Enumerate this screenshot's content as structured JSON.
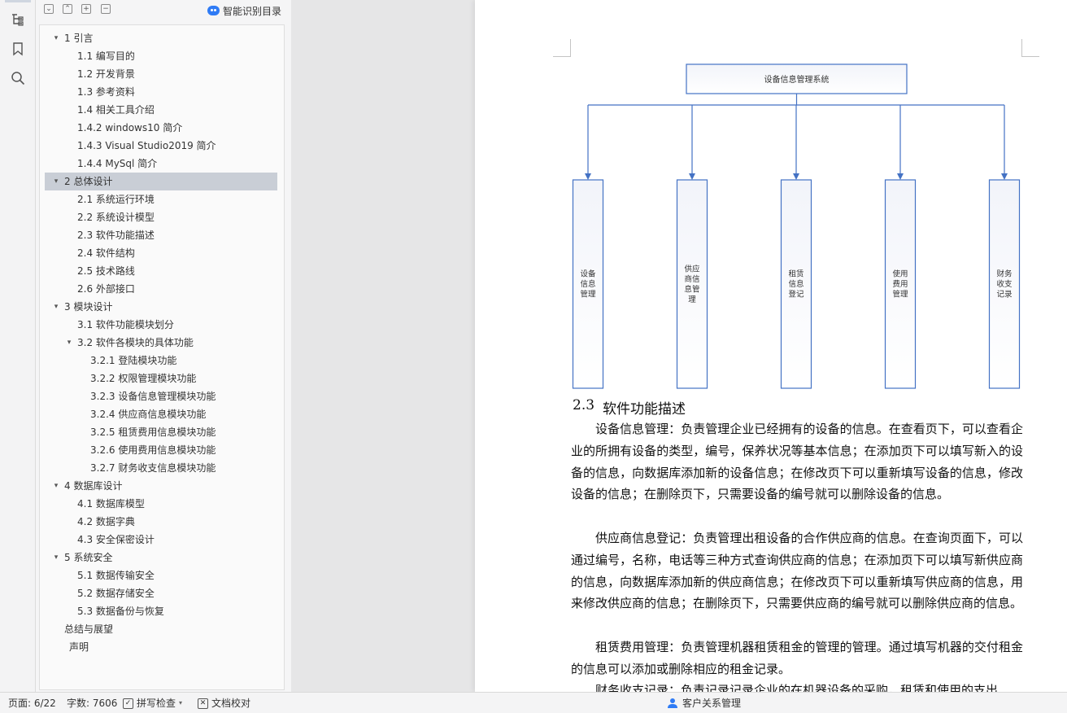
{
  "outline": {
    "smart_toc_label": "智能识别目录",
    "items": [
      {
        "label": "1  引言",
        "level": 1,
        "expanded": true
      },
      {
        "label": "1.1  编写目的",
        "level": 2
      },
      {
        "label": "1.2  开发背景",
        "level": 2
      },
      {
        "label": "1.3  参考资料",
        "level": 2
      },
      {
        "label": "1.4  相关工具介绍",
        "level": 2
      },
      {
        "label": "1.4.2 windows10 简介",
        "level": 2
      },
      {
        "label": "1.4.3 Visual Studio2019 简介",
        "level": 2
      },
      {
        "label": "1.4.4 MySql 简介",
        "level": 2
      },
      {
        "label": "2  总体设计",
        "level": 1,
        "expanded": true,
        "selected": true
      },
      {
        "label": "2.1  系统运行环境",
        "level": 2
      },
      {
        "label": "2.2  系统设计模型",
        "level": 2
      },
      {
        "label": "2.3  软件功能描述",
        "level": 2
      },
      {
        "label": "2.4  软件结构",
        "level": 2
      },
      {
        "label": "2.5  技术路线",
        "level": 2
      },
      {
        "label": "2.6  外部接口",
        "level": 2
      },
      {
        "label": "3  模块设计",
        "level": 1,
        "expanded": true
      },
      {
        "label": "3.1  软件功能模块划分",
        "level": 2
      },
      {
        "label": "3.2  软件各模块的具体功能",
        "level": 2,
        "expanded": true
      },
      {
        "label": "3.2.1 登陆模块功能",
        "level": 3
      },
      {
        "label": "3.2.2 权限管理模块功能",
        "level": 3
      },
      {
        "label": "3.2.3 设备信息管理模块功能",
        "level": 3
      },
      {
        "label": "3.2.4 供应商信息模块功能",
        "level": 3
      },
      {
        "label": "3.2.5 租赁费用信息模块功能",
        "level": 3
      },
      {
        "label": "3.2.6 使用费用信息模块功能",
        "level": 3
      },
      {
        "label": "3.2.7 财务收支信息模块功能",
        "level": 3
      },
      {
        "label": "4  数据库设计",
        "level": 1,
        "expanded": true
      },
      {
        "label": "4.1  数据库模型",
        "level": 2
      },
      {
        "label": "4.2  数据字典",
        "level": 2
      },
      {
        "label": "4.3  安全保密设计",
        "level": 2
      },
      {
        "label": "5  系统安全",
        "level": 1,
        "expanded": true
      },
      {
        "label": "5.1  数据传输安全",
        "level": 2
      },
      {
        "label": "5.2  数据存储安全",
        "level": 2
      },
      {
        "label": "5.3  数据备份与恢复",
        "level": 2
      },
      {
        "label": "总结与展望",
        "level": 0
      },
      {
        "label": "声明",
        "level": 0
      }
    ]
  },
  "diagram": {
    "root": "设备信息管理系统",
    "children": [
      [
        "设备",
        "信息",
        "管理"
      ],
      [
        "供应",
        "商信",
        "息管",
        "理"
      ],
      [
        "租赁",
        "信息",
        "登记"
      ],
      [
        "使用",
        "费用",
        "管理"
      ],
      [
        "财务",
        "收支",
        "记录"
      ]
    ]
  },
  "document": {
    "heading_number": "2.3",
    "heading_title": "软件功能描述",
    "paragraphs": [
      "设备信息管理：负责管理企业已经拥有的设备的信息。在查看页下，可以查看企业的所拥有设备的类型，编号，保养状况等基本信息；在添加页下可以填写新入的设备的信息，向数据库添加新的设备信息；在修改页下可以重新填写设备的信息，修改设备的信息；在删除页下，只需要设备的编号就可以删除设备的信息。",
      "供应商信息登记：负责管理出租设备的合作供应商的信息。在查询页面下，可以通过编号，名称，电话等三种方式查询供应商的信息；在添加页下可以填写新供应商的信息，向数据库添加新的供应商信息；在修改页下可以重新填写供应商的信息，用来修改供应商的信息；在删除页下，只需要供应商的编号就可以删除供应商的信息。",
      "租赁费用管理：负责管理机器租赁租金的管理的管理。通过填写机器的交付租金的信息可以添加或删除相应的租金记录。",
      "财务收支记录：负责记录记录企业的在机器设备的采购，租赁和使用的支出"
    ]
  },
  "status": {
    "page": "页面: 6/22",
    "words": "字数: 7606",
    "spellcheck": "拼写检查",
    "proofread": "文档校对",
    "crm": "客户关系管理"
  },
  "colors": {
    "diagram_stroke": "#4472c4",
    "diagram_fill_top": "#f2f4fa",
    "selected_row": "#c9ced6",
    "accent": "#2f7bf5"
  }
}
